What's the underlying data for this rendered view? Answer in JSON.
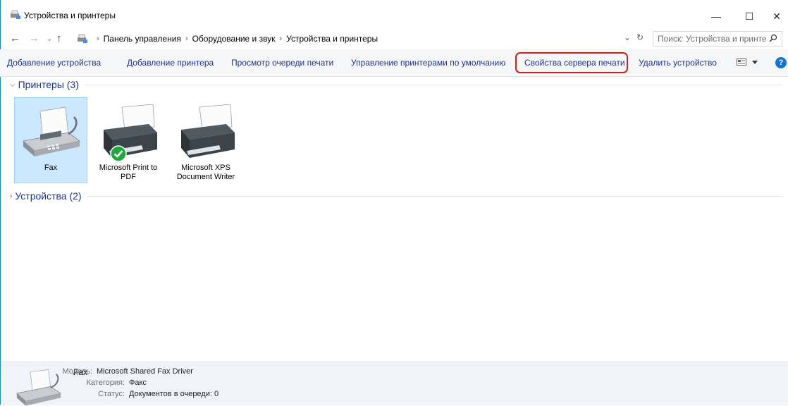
{
  "window": {
    "title": "Устройства и принтеры",
    "minimize": "—",
    "maximize": "☐",
    "close": "✕"
  },
  "nav": {
    "back": "←",
    "forward": "→",
    "history": "⌄",
    "up": "↑",
    "breadcrumb": [
      "Панель управления",
      "Оборудование и звук",
      "Устройства и принтеры"
    ],
    "separator": "›",
    "dropdown": "⌄",
    "refresh": "↻",
    "search_placeholder": "Поиск: Устройства и принте..."
  },
  "commands": [
    "Добавление устройства",
    "Добавление принтера",
    "Просмотр очереди печати",
    "Управление принтерами по умолчанию",
    "Свойства сервера печати",
    "Удалить устройство"
  ],
  "help": "?",
  "groups": {
    "printers": {
      "label": "Принтеры (3)",
      "expanded": true
    },
    "devices": {
      "label": "Устройства (2)",
      "expanded": false
    }
  },
  "printers": [
    {
      "name": "Fax",
      "selected": true,
      "default": false,
      "icon": "fax-icon"
    },
    {
      "name": "Microsoft Print to PDF",
      "selected": false,
      "default": true,
      "icon": "printer-icon"
    },
    {
      "name": "Microsoft XPS Document Writer",
      "selected": false,
      "default": false,
      "icon": "printer-icon"
    }
  ],
  "details": {
    "name": "Fax",
    "rows": [
      {
        "key": "Модель:",
        "value": "Microsoft Shared Fax Driver"
      },
      {
        "key": "Категория:",
        "value": "Факс"
      },
      {
        "key": "Статус:",
        "value": "Документов в очереди: 0"
      }
    ]
  },
  "colors": {
    "link": "#1e3287",
    "selection": "#cce8ff",
    "highlight": "#c8201d",
    "help": "#1670d6",
    "details_bg": "#f0f3f9"
  }
}
